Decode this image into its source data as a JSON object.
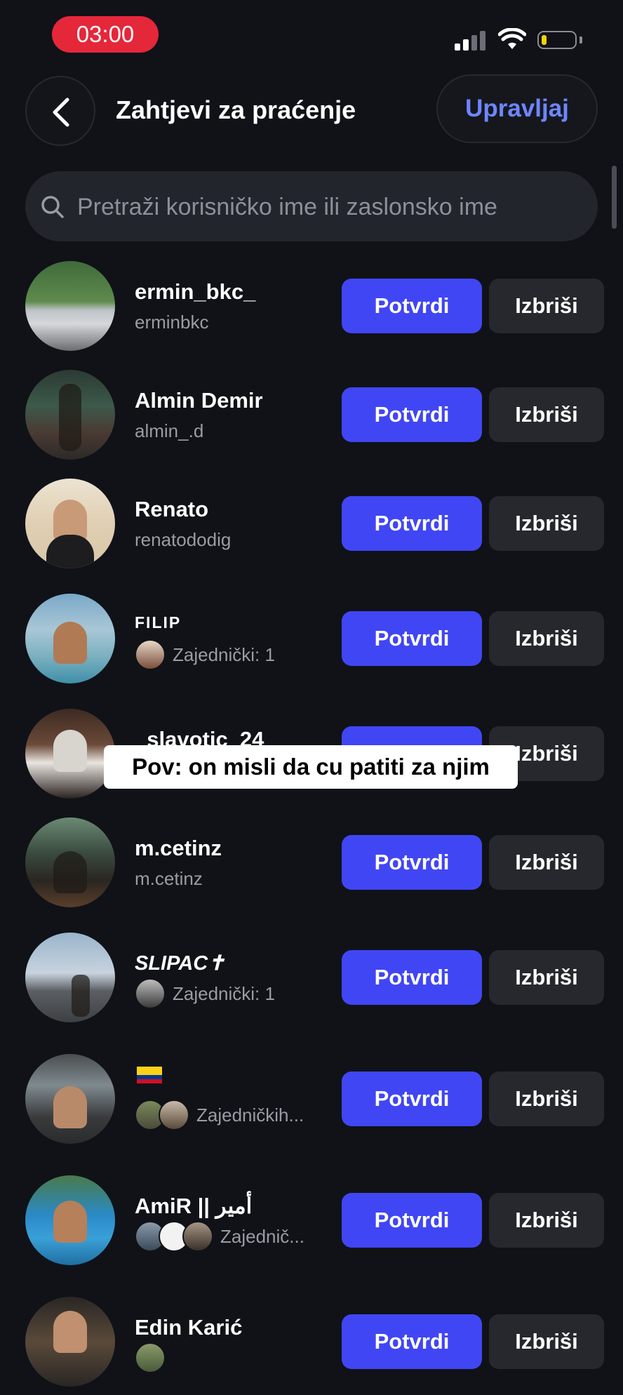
{
  "status_bar": {
    "time": "03:00"
  },
  "header": {
    "back_icon": "chevron-left-icon",
    "title": "Zahtjevi za praćenje",
    "manage_label": "Upravljaj"
  },
  "search": {
    "icon": "search-icon",
    "placeholder": "Pretraži korisničko ime ili zaslonsko ime"
  },
  "buttons": {
    "confirm_label": "Potvrdi",
    "delete_label": "Izbriši"
  },
  "colors": {
    "accent": "#4146f4",
    "link": "#6f86ff",
    "background": "#101218",
    "recording": "#e5273a"
  },
  "requests": [
    {
      "username": "ermin_bkc_",
      "subtitle": "erminbkc",
      "confirm": "Potvrdi",
      "delete": "Izbriši"
    },
    {
      "username": "Almin Demir",
      "subtitle": "almin_.d",
      "confirm": "Potvrdi",
      "delete": "Izbriši"
    },
    {
      "username": "Renato",
      "subtitle": "renatododig",
      "confirm": "Potvrdi",
      "delete": "Izbriši"
    },
    {
      "username": "FILIP",
      "mutual": "Zajednički: 1",
      "confirm": "Potvrdi",
      "delete": "Izbriši"
    },
    {
      "username": "_slavotic_24",
      "confirm": "Potvrdi",
      "delete": "Izbriši"
    },
    {
      "username": "m.cetinz",
      "subtitle": "m.cetinz",
      "confirm": "Potvrdi",
      "delete": "Izbriši"
    },
    {
      "username": "SLIPAC✝",
      "mutual": "Zajednički: 1",
      "confirm": "Potvrdi",
      "delete": "Izbriši"
    },
    {
      "username": "",
      "flag": "colombia-flag-icon",
      "mutual": "Zajedničkih...",
      "confirm": "Potvrdi",
      "delete": "Izbriši"
    },
    {
      "username": "AmiR || أمير",
      "mutual": "Zajednič...",
      "confirm": "Potvrdi",
      "delete": "Izbriši"
    },
    {
      "username": "Edin Karić",
      "confirm": "Potvrdi",
      "delete": "Izbriši"
    }
  ],
  "caption": "Pov: on misli da cu patiti za njim"
}
